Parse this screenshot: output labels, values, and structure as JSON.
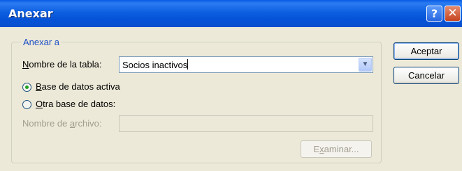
{
  "window": {
    "title": "Anexar",
    "help_glyph": "?",
    "close_glyph": "✕"
  },
  "group": {
    "label": "Anexar a",
    "table_name_label_first": "N",
    "table_name_label_rest": "ombre de la tabla:",
    "table_name_value": "Socios inactivos",
    "radio_active_first": "B",
    "radio_active_rest": "ase de datos activa",
    "radio_active_checked": true,
    "radio_other_first": "O",
    "radio_other_rest": "tra base de datos:",
    "radio_other_checked": false,
    "file_name_label_pre": "Nombre de ",
    "file_name_label_u": "a",
    "file_name_label_post": "rchivo:",
    "file_name_value": "",
    "browse_pre": "E",
    "browse_u": "x",
    "browse_post": "aminar..."
  },
  "buttons": {
    "accept": "Aceptar",
    "cancel": "Cancelar"
  },
  "icons": {
    "dropdown": "chevron-down-icon",
    "help": "help-icon",
    "close": "close-icon"
  },
  "colors": {
    "titlebar": "#0553d8",
    "dialog_bg": "#ece9d8",
    "group_label": "#1c4fc5",
    "disabled_text": "#a19e8f",
    "radio_dot": "#21a121"
  }
}
